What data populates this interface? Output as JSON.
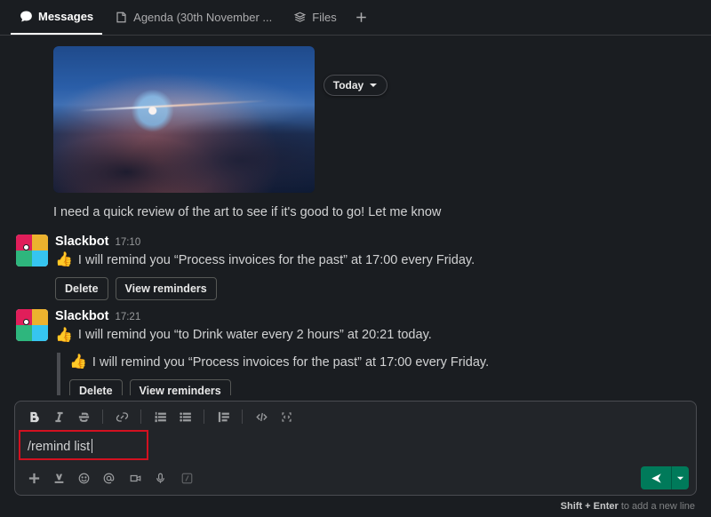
{
  "tabs": {
    "messages": "Messages",
    "agenda": "Agenda (30th November ...",
    "files": "Files"
  },
  "date_divider": "Today",
  "prior_message": "I need a quick review of the art to see if it's good to go! Let me know",
  "bot1": {
    "sender": "Slackbot",
    "time": "17:10",
    "line": "I will remind you “Process invoices for the past” at 17:00 every Friday.",
    "delete": "Delete",
    "view": "View reminders"
  },
  "bot2": {
    "sender": "Slackbot",
    "time": "17:21",
    "line": "I will remind you “to Drink water every 2 hours” at 20:21 today.",
    "threaded_line": "I will remind you “Process invoices for the past” at 17:00 every Friday.",
    "delete": "Delete",
    "view": "View reminders"
  },
  "composer": {
    "value": "/remind list"
  },
  "hint": {
    "keys": "Shift + Enter",
    "rest": " to add a new line"
  }
}
